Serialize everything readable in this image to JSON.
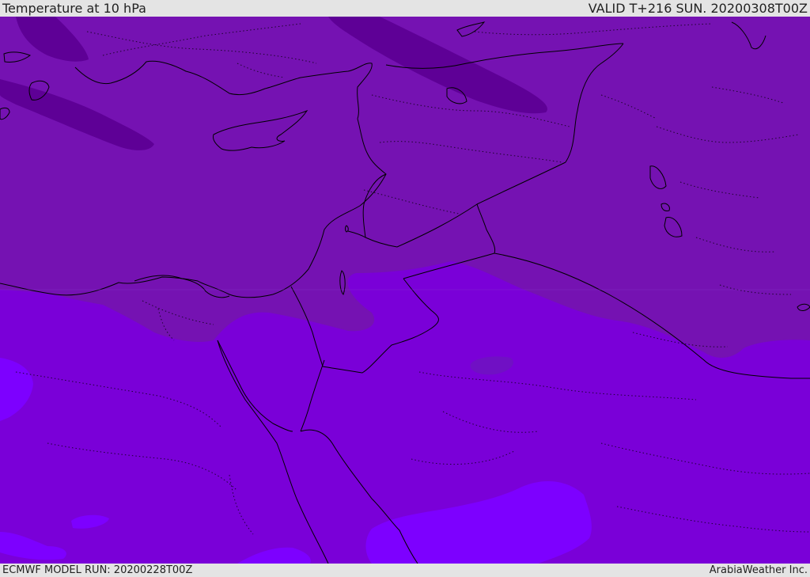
{
  "header": {
    "title": "Temperature at 10 hPa",
    "valid": "VALID T+216 SUN. 20200308T00Z"
  },
  "footer": {
    "model_run": "ECMWF MODEL RUN: 20200228T00Z",
    "credit": "ArabiaWeather Inc."
  },
  "colors": {
    "bar_background": "#e4e4e4",
    "band_dark": "#5e0096",
    "band_upper": "#7512b2",
    "band_main": "#7a00d8",
    "band_light": "#7d00ff",
    "band_mid": "#7010c4",
    "coastline": "#000000"
  },
  "map": {
    "field": "temperature",
    "level": "10 hPa",
    "region": "Eastern Mediterranean and Middle East"
  }
}
